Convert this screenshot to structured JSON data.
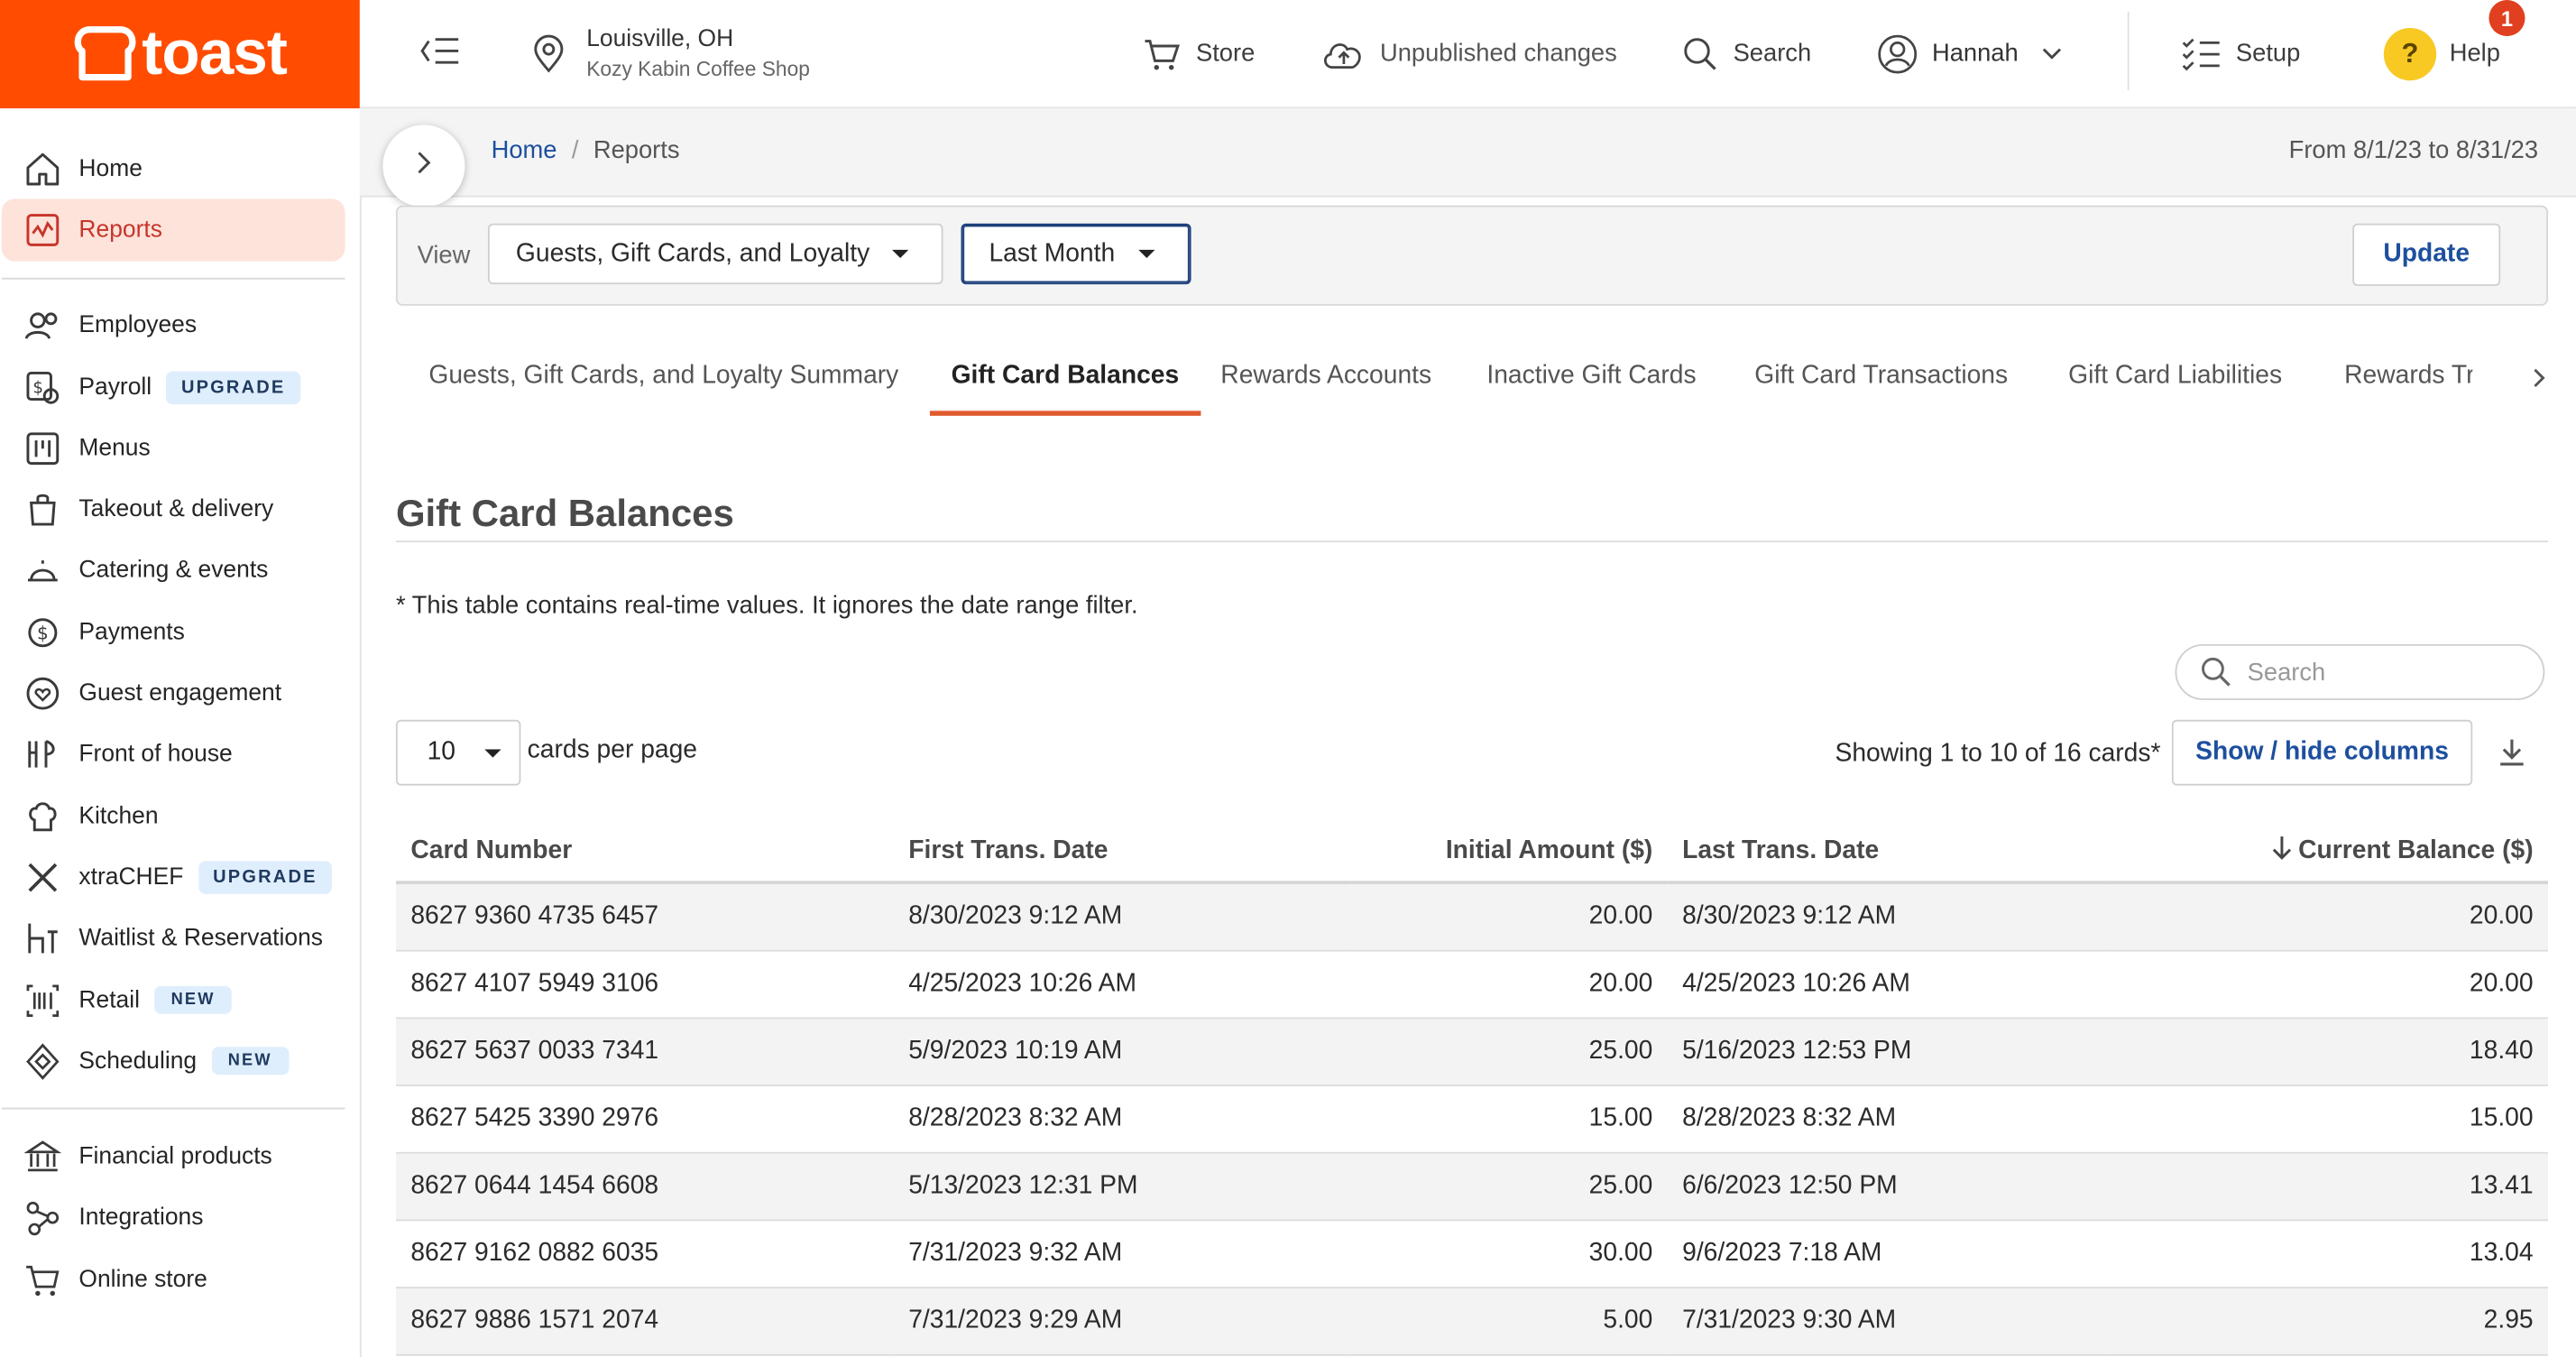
{
  "brand": {
    "name": "toast",
    "color": "#ff4c00"
  },
  "sidebar": {
    "groups": [
      [
        {
          "label": "Home",
          "icon": "home-icon"
        },
        {
          "label": "Reports",
          "icon": "reports-icon",
          "active": true
        }
      ],
      [
        {
          "label": "Employees",
          "icon": "employees-icon"
        },
        {
          "label": "Payroll",
          "icon": "payroll-icon",
          "tag": "UPGRADE"
        },
        {
          "label": "Menus",
          "icon": "menus-icon"
        },
        {
          "label": "Takeout & delivery",
          "icon": "takeout-icon"
        },
        {
          "label": "Catering & events",
          "icon": "catering-icon"
        },
        {
          "label": "Payments",
          "icon": "payments-icon"
        },
        {
          "label": "Guest engagement",
          "icon": "guest-engagement-icon"
        },
        {
          "label": "Front of house",
          "icon": "front-of-house-icon"
        },
        {
          "label": "Kitchen",
          "icon": "kitchen-icon"
        },
        {
          "label": "xtraCHEF",
          "icon": "xtrachef-icon",
          "tag": "UPGRADE"
        },
        {
          "label": "Waitlist & Reservations",
          "icon": "waitlist-icon"
        },
        {
          "label": "Retail",
          "icon": "retail-icon",
          "tag": "NEW"
        },
        {
          "label": "Scheduling",
          "icon": "scheduling-icon",
          "tag": "NEW"
        }
      ],
      [
        {
          "label": "Financial products",
          "icon": "bank-icon"
        },
        {
          "label": "Integrations",
          "icon": "integrations-icon"
        },
        {
          "label": "Online store",
          "icon": "cart-icon"
        }
      ]
    ]
  },
  "topbar": {
    "location_city": "Louisville, OH",
    "location_name": "Kozy Kabin Coffee Shop",
    "store": "Store",
    "unpublished": "Unpublished changes",
    "search": "Search",
    "user": "Hannah",
    "setup": "Setup",
    "help": "Help",
    "help_glyph": "?",
    "help_badge": "1"
  },
  "breadcrumb": {
    "home": "Home",
    "current": "Reports"
  },
  "date_range": "From 8/1/23 to 8/31/23",
  "filters": {
    "view_label": "View",
    "view_value": "Guests, Gift Cards, and Loyalty",
    "period_value": "Last Month",
    "update": "Update"
  },
  "tabs": [
    "Guests, Gift Cards, and Loyalty Summary",
    "Gift Card Balances",
    "Rewards Accounts",
    "Inactive Gift Cards",
    "Gift Card Transactions",
    "Gift Card Liabilities",
    "Rewards Tr"
  ],
  "active_tab": "Gift Card Balances",
  "report": {
    "title": "Gift Card Balances",
    "note": "* This table contains real-time values. It ignores the date range filter.",
    "search_placeholder": "Search",
    "per_page": "10",
    "per_page_label": "cards per page",
    "showing": "Showing 1 to 10 of 16 cards*",
    "show_hide": "Show / hide columns",
    "columns": [
      "Card Number",
      "First Trans. Date",
      "Initial Amount ($)",
      "Last Trans. Date",
      "Current Balance ($)"
    ],
    "rows": [
      [
        "8627 9360 4735 6457",
        "8/30/2023 9:12 AM",
        "20.00",
        "8/30/2023 9:12 AM",
        "20.00"
      ],
      [
        "8627 4107 5949 3106",
        "4/25/2023 10:26 AM",
        "20.00",
        "4/25/2023 10:26 AM",
        "20.00"
      ],
      [
        "8627 5637 0033 7341",
        "5/9/2023 10:19 AM",
        "25.00",
        "5/16/2023 12:53 PM",
        "18.40"
      ],
      [
        "8627 5425 3390 2976",
        "8/28/2023 8:32 AM",
        "15.00",
        "8/28/2023 8:32 AM",
        "15.00"
      ],
      [
        "8627 0644 1454 6608",
        "5/13/2023 12:31 PM",
        "25.00",
        "6/6/2023 12:50 PM",
        "13.41"
      ],
      [
        "8627 9162 0882 6035",
        "7/31/2023 9:32 AM",
        "30.00",
        "9/6/2023 7:18 AM",
        "13.04"
      ],
      [
        "8627 9886 1571 2074",
        "7/31/2023 9:29 AM",
        "5.00",
        "7/31/2023 9:30 AM",
        "2.95"
      ]
    ]
  }
}
